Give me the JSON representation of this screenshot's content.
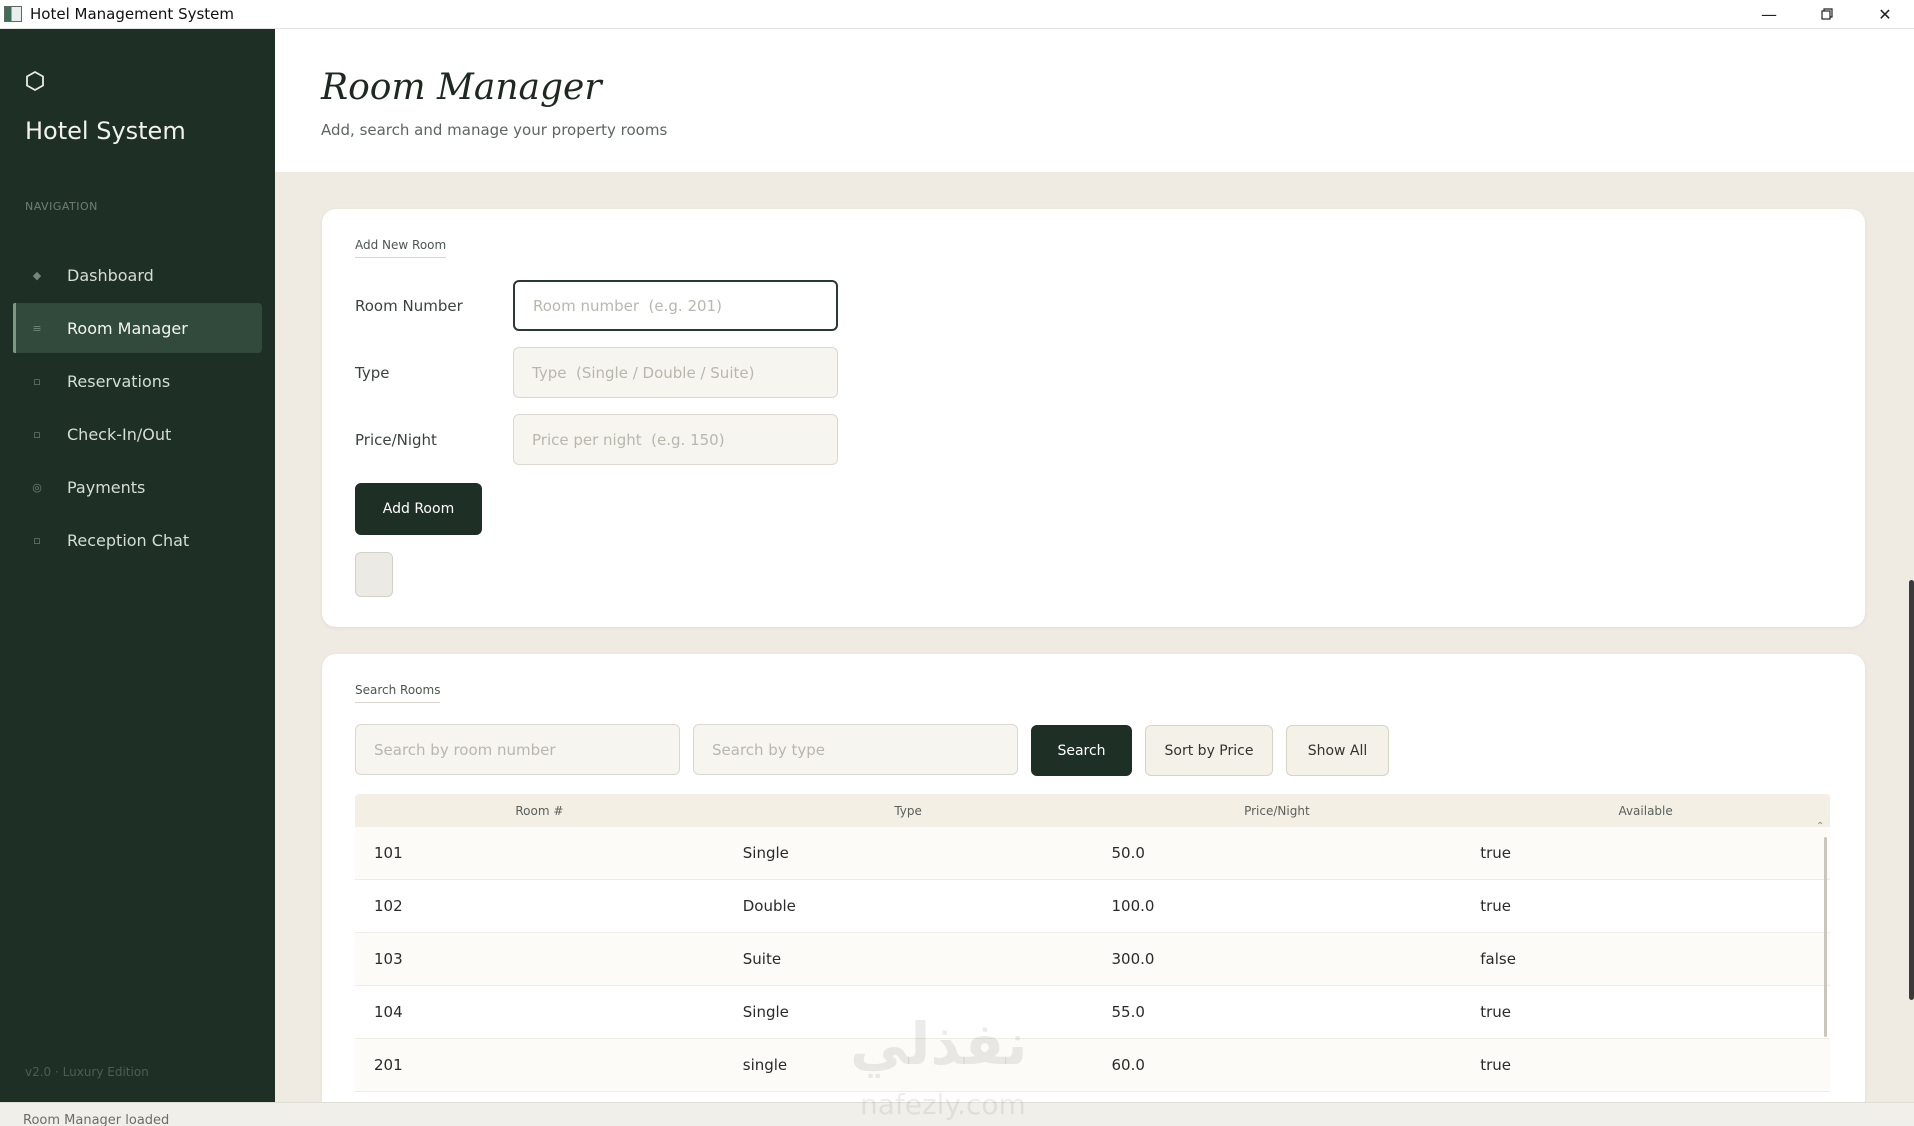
{
  "window": {
    "title": "Hotel Management System"
  },
  "sidebar": {
    "brand": "Hotel System",
    "nav_label": "NAVIGATION",
    "items": [
      {
        "label": "Dashboard",
        "icon": "◆",
        "active": false
      },
      {
        "label": "Room Manager",
        "icon": "≡",
        "active": true
      },
      {
        "label": "Reservations",
        "icon": "▫",
        "active": false
      },
      {
        "label": "Check-In/Out",
        "icon": "▫",
        "active": false
      },
      {
        "label": "Payments",
        "icon": "◎",
        "active": false
      },
      {
        "label": "Reception Chat",
        "icon": "▫",
        "active": false
      }
    ],
    "version": "v2.0  ·  Luxury Edition"
  },
  "header": {
    "title": "Room Manager",
    "subtitle": "Add, search and manage your property rooms"
  },
  "add_room": {
    "section_label": "Add New Room",
    "room_number_label": "Room Number",
    "room_number_placeholder": "Room number  (e.g. 201)",
    "type_label": "Type",
    "type_placeholder": "Type  (Single / Double / Suite)",
    "price_label": "Price/Night",
    "price_placeholder": "Price per night  (e.g. 150)",
    "add_button": "Add Room"
  },
  "search": {
    "section_label": "Search Rooms",
    "room_placeholder": "Search by room number",
    "type_placeholder": "Search by type",
    "search_button": "Search",
    "sort_button": "Sort by Price",
    "show_all_button": "Show All"
  },
  "table": {
    "headers": [
      "Room #",
      "Type",
      "Price/Night",
      "Available"
    ],
    "rows": [
      [
        "101",
        "Single",
        "50.0",
        "true"
      ],
      [
        "102",
        "Double",
        "100.0",
        "true"
      ],
      [
        "103",
        "Suite",
        "300.0",
        "false"
      ],
      [
        "104",
        "Single",
        "55.0",
        "true"
      ],
      [
        "201",
        "single",
        "60.0",
        "true"
      ]
    ]
  },
  "status": {
    "text": "Room Manager loaded"
  },
  "watermark": {
    "text": "نفذلي",
    "sub": "nafezly.com"
  },
  "colors": {
    "sidebar": "#1e2f26",
    "accent": "#1e2f26",
    "background": "#efebe2"
  }
}
